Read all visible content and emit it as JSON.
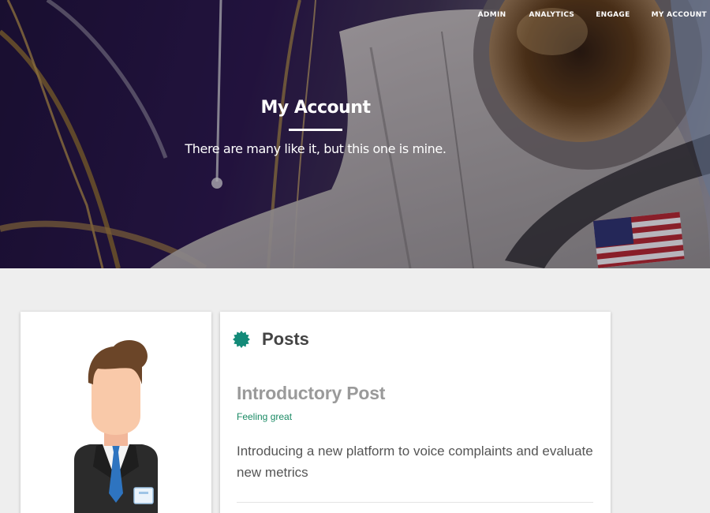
{
  "nav": {
    "items": [
      {
        "label": "ADMIN"
      },
      {
        "label": "ANALYTICS"
      },
      {
        "label": "ENGAGE"
      },
      {
        "label": "MY ACCOUNT"
      }
    ]
  },
  "hero": {
    "title": "My Account",
    "subtitle": "There are many like it, but this one is mine."
  },
  "posts": {
    "heading": "Posts",
    "heading_icon": "seal-badge-icon",
    "accent_color": "#138a78",
    "items": [
      {
        "title": "Introductory Post",
        "mood": "Feeling great",
        "body": "Introducing a new platform to voice complaints and evaluate new metrics"
      }
    ]
  },
  "profile": {
    "avatar_icon": "businessman-avatar-icon"
  }
}
